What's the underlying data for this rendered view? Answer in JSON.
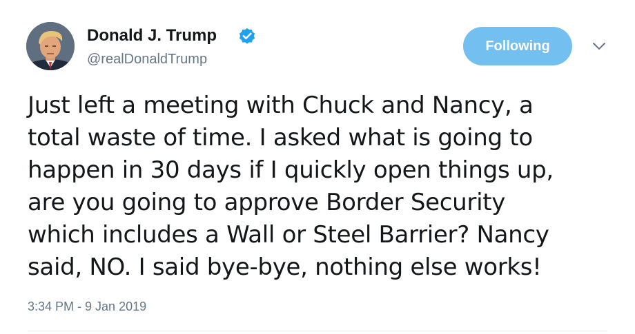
{
  "user": {
    "display_name": "Donald J. Trump",
    "handle": "@realDonaldTrump",
    "verified": true,
    "avatar": "profile-photo"
  },
  "actions": {
    "follow_label": "Following",
    "menu_icon": "chevron-down-icon"
  },
  "tweet": {
    "text": "Just left a meeting with Chuck and Nancy, a\ntotal waste of time. I asked what is going to\nhappen in 30 days if I quickly open things up,\nare you going to approve Border Security\nwhich includes a Wall or Steel Barrier? Nancy\nsaid, NO. I said bye-bye, nothing else works!",
    "timestamp": "3:34 PM - 9 Jan 2019"
  },
  "colors": {
    "follow_button": "#72bff0",
    "verified_badge": "#1da1f2",
    "secondary_text": "#657786",
    "primary_text": "#14171a"
  }
}
